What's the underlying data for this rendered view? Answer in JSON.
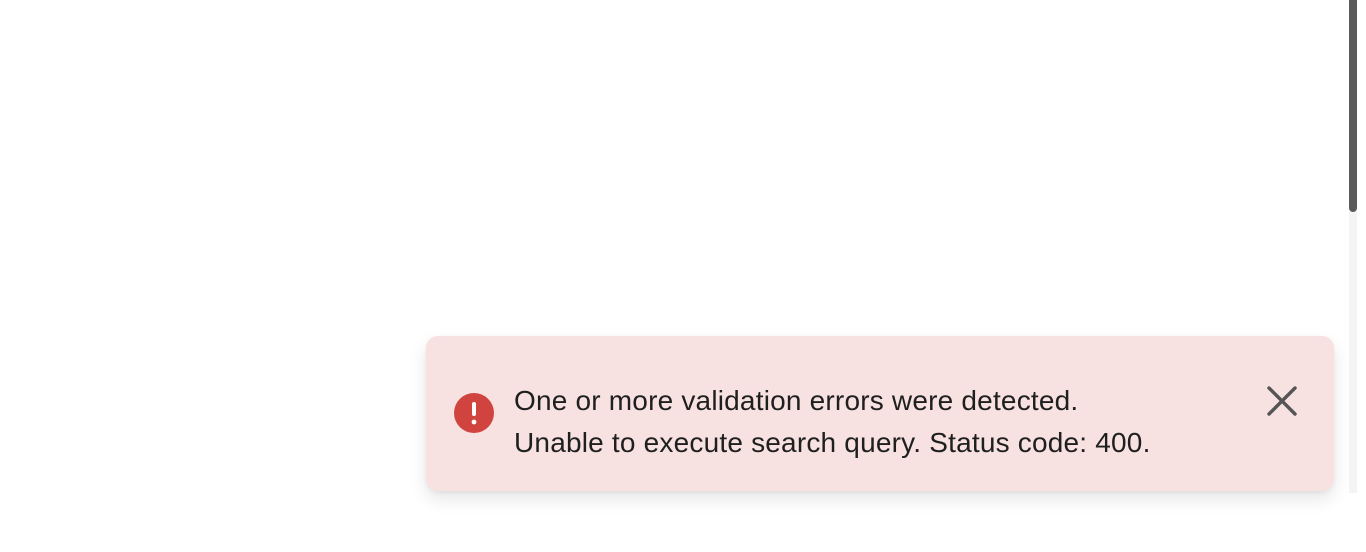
{
  "notification": {
    "type": "error",
    "message_line_1": "One or more validation errors were detected.",
    "message_line_2": "Unable to execute search query. Status code: 400.",
    "icon": "error-exclamation-icon",
    "close_icon": "close-icon"
  },
  "colors": {
    "toast_background": "#f7e1e1",
    "error_accent": "#d0433f",
    "text": "#1f1f1f",
    "close_icon": "#555555",
    "scrollbar_thumb": "#5a5a5a"
  },
  "scrollbar": {
    "position_fraction": 0.0
  }
}
